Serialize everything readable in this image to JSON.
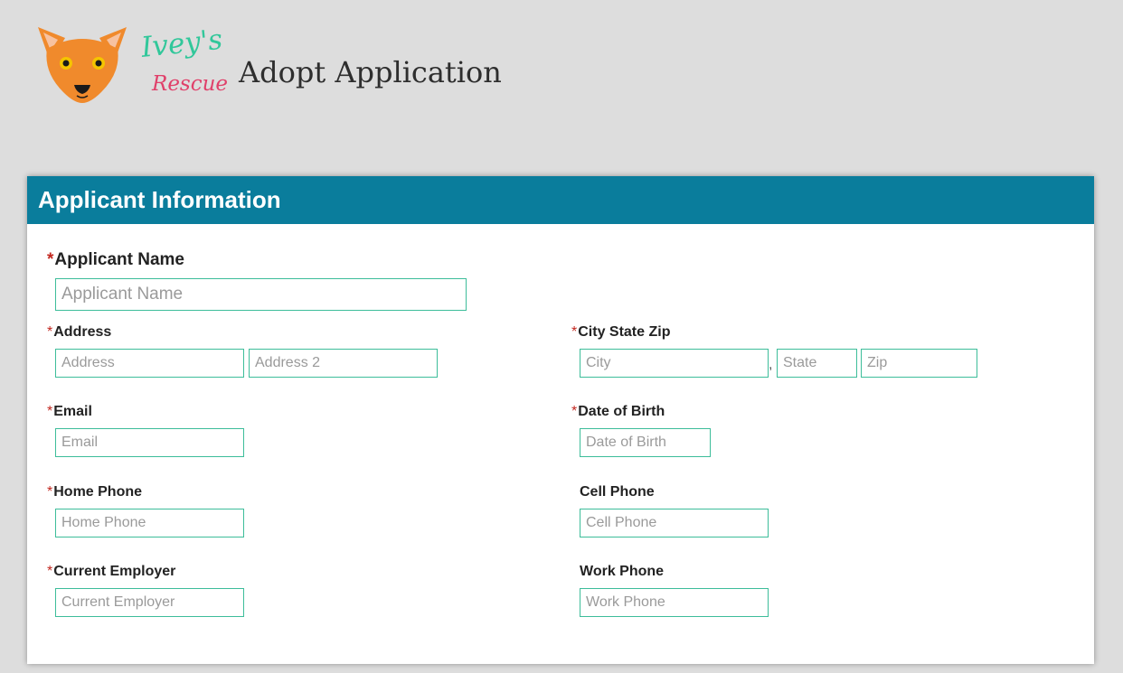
{
  "header": {
    "logo_line1": "Ivey's",
    "logo_line2": "Rescue",
    "title": "Adopt Application"
  },
  "section": {
    "title": "Applicant Information"
  },
  "required_marker": "*",
  "city_state_separator": ",",
  "fields": {
    "applicant_name": {
      "label": "Applicant Name",
      "placeholder": "Applicant Name",
      "value": "",
      "required": true
    },
    "address": {
      "label": "Address",
      "placeholder": "Address",
      "placeholder2": "Address 2",
      "value": "",
      "value2": "",
      "required": true
    },
    "city_state_zip": {
      "label": "City State Zip",
      "city_placeholder": "City",
      "state_placeholder": "State",
      "zip_placeholder": "Zip",
      "required": true
    },
    "email": {
      "label": "Email",
      "placeholder": "Email",
      "value": "",
      "required": true
    },
    "date_of_birth": {
      "label": "Date of Birth",
      "placeholder": "Date of Birth",
      "value": "",
      "required": true
    },
    "home_phone": {
      "label": "Home Phone",
      "placeholder": "Home Phone",
      "value": "",
      "required": true
    },
    "cell_phone": {
      "label": "Cell Phone",
      "placeholder": "Cell Phone",
      "value": "",
      "required": false
    },
    "current_employer": {
      "label": "Current Employer",
      "placeholder": "Current Employer",
      "value": "",
      "required": true
    },
    "work_phone": {
      "label": "Work Phone",
      "placeholder": "Work Phone",
      "value": "",
      "required": false
    }
  },
  "colors": {
    "background": "#dddddd",
    "header_bar": "#0a7d9c",
    "field_border": "#3dbd9a",
    "required": "#c2271f",
    "logo_orange": "#f08a2c",
    "logo_green": "#31c79a",
    "logo_pink": "#e0406a"
  },
  "icons": {
    "logo": "dog-face-icon"
  }
}
